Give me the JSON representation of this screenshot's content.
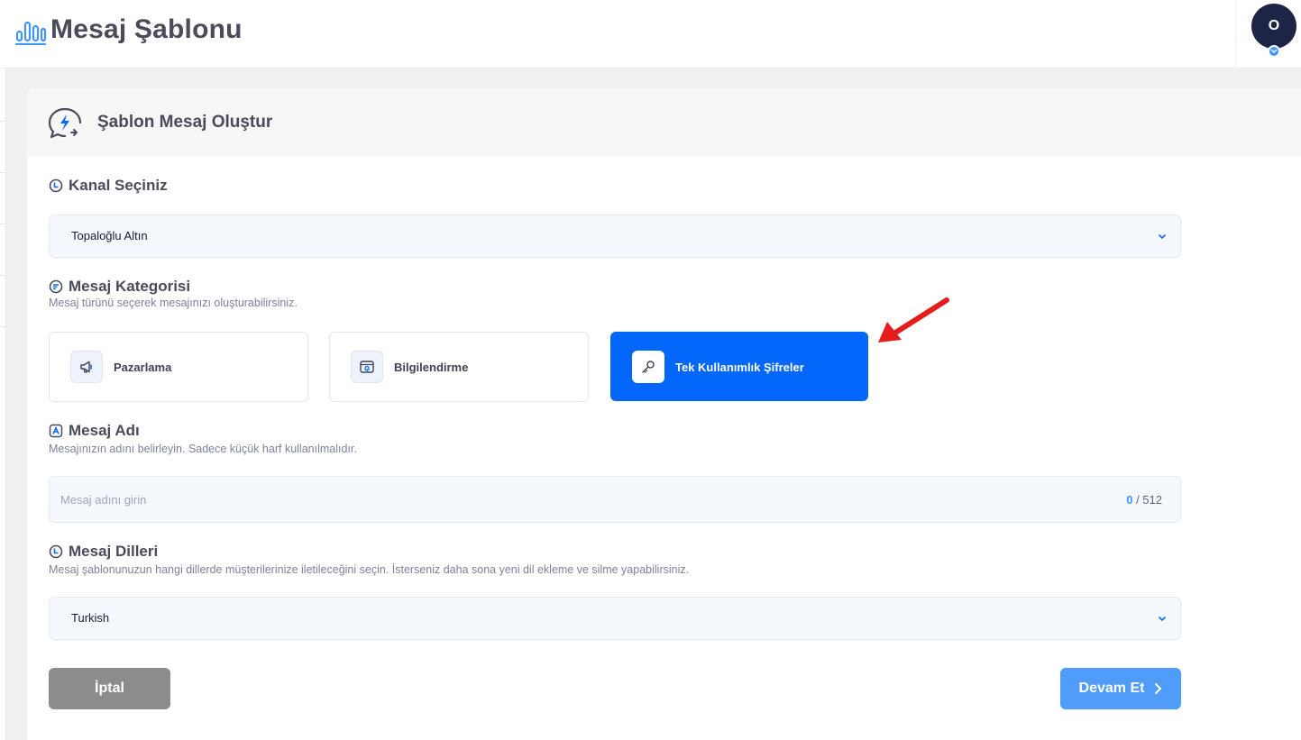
{
  "header": {
    "title": "Mesaj Şablonu",
    "avatar_initial": "O"
  },
  "card": {
    "title": "Şablon Mesaj Oluştur"
  },
  "channel": {
    "label": "Kanal Seçiniz",
    "selected": "Topaloğlu Altın"
  },
  "category": {
    "label": "Mesaj Kategorisi",
    "description": "Mesaj türünü seçerek mesajınızı oluşturabilirsiniz.",
    "options": [
      {
        "label": "Pazarlama",
        "icon": "megaphone-icon",
        "active": false
      },
      {
        "label": "Bilgilendirme",
        "icon": "notification-icon",
        "active": false
      },
      {
        "label": "Tek Kullanımlık Şifreler",
        "icon": "key-icon",
        "active": true
      }
    ]
  },
  "name_field": {
    "label": "Mesaj Adı",
    "description": "Mesajınızın adını belirleyin. Sadece küçük harf kullanılmalıdır.",
    "placeholder": "Mesaj adını girin",
    "value": "",
    "count": "0",
    "separator": " / ",
    "max": "512"
  },
  "languages": {
    "label": "Mesaj Dilleri",
    "description": "Mesaj şablonunuzun hangi dillerde müşterilerinize iletileceğini seçin. İsterseniz daha sona yeni dil ekleme ve silme yapabilirsiniz.",
    "selected": "Turkish"
  },
  "actions": {
    "cancel_label": "İptal",
    "next_label": "Devam Et"
  },
  "colors": {
    "primary": "#0467fb",
    "next_button": "#4f9cf9",
    "cancel_button": "#8c8c8c",
    "annotation_arrow": "#e51c1c",
    "avatar": "#1e2446"
  }
}
